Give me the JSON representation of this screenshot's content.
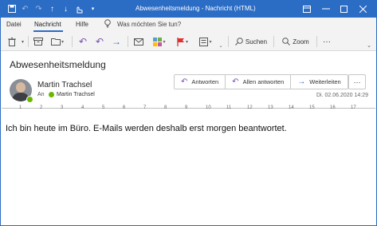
{
  "window": {
    "title": "Abwesenheitsmeldung  -  Nachricht (HTML)",
    "accent_color": "#2b6cc4"
  },
  "quick_access": {
    "icons": [
      "save-icon",
      "undo-icon",
      "redo-icon",
      "up-icon",
      "down-icon",
      "touch-mode-icon",
      "customize-caret-icon"
    ]
  },
  "menu": {
    "tabs": [
      "Datei",
      "Nachricht",
      "Hilfe"
    ],
    "active_tab": "Nachricht",
    "tell_me_placeholder": "Was möchten Sie tun?"
  },
  "ribbon": {
    "search_label": "Suchen",
    "zoom_label": "Zoom",
    "more_label": "···"
  },
  "message": {
    "subject": "Abwesenheitsmeldung",
    "sender": "Martin Trachsel",
    "to_label": "An",
    "recipient": "Martin Trachsel",
    "date": "Di. 02.06.2020 14:29",
    "actions": {
      "reply": "Antworten",
      "reply_all": "Allen antworten",
      "forward": "Weiterleiten",
      "more": "···"
    },
    "body": "Ich bin heute im Büro. E-Mails werden deshalb erst morgen beantwortet."
  },
  "ruler": {
    "ticks": [
      "1",
      "2",
      "3",
      "4",
      "5",
      "6",
      "7",
      "8",
      "9",
      "10",
      "11",
      "12",
      "13",
      "14",
      "15",
      "16",
      "17"
    ]
  }
}
